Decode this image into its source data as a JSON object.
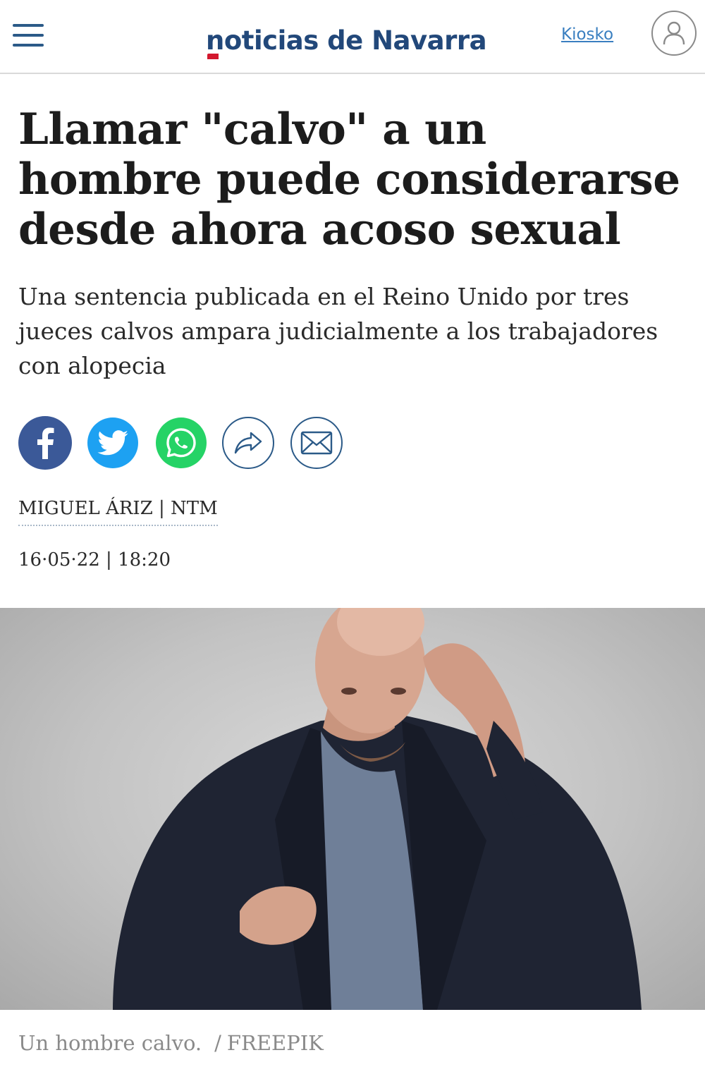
{
  "header": {
    "logo_text": "noticias de Navarra",
    "kiosko_label": "Kiosko"
  },
  "article": {
    "headline": "Llamar \"calvo\" a un hombre puede considerarse desde ahora acoso sexual",
    "subtitle": "Una sentencia publicada en el Reino Unido por tres jueces calvos ampara judicialmente a los trabajadores con alopecia",
    "byline": "MIGUEL ÁRIZ | NTM",
    "date": "16·05·22 | 18:20"
  },
  "share": {
    "icons": [
      "facebook-icon",
      "twitter-icon",
      "whatsapp-icon",
      "share-icon",
      "email-icon"
    ]
  },
  "image": {
    "caption": "Un hombre calvo.",
    "credit": "FREEPIK"
  },
  "colors": {
    "brand": "#22487a",
    "accent": "#d3182e",
    "facebook": "#3b5998",
    "twitter": "#1da1f2",
    "whatsapp": "#25d366"
  }
}
